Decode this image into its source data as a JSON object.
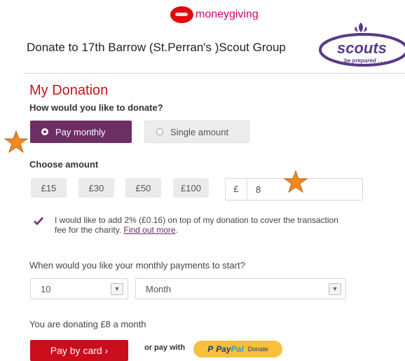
{
  "header": {
    "brand_name": "moneygiving",
    "brand_badge": "Virgin",
    "page_title": "Donate to 17th Barrow (St.Perran's )Scout Group",
    "org_logo_text": "scouts",
    "org_logo_tagline": "be prepared . . ."
  },
  "form": {
    "section_title": "My Donation",
    "frequency_question": "How would you like to donate?",
    "frequency_options": {
      "monthly": "Pay monthly",
      "single": "Single amount"
    },
    "frequency_selected": "monthly",
    "amount_question": "Choose amount",
    "preset_amounts": [
      "£15",
      "£30",
      "£50",
      "£100"
    ],
    "currency_symbol": "£",
    "amount_value": "8",
    "fee_checkbox_checked": true,
    "fee_text": "I would like to add 2% (£0.16) on top of my donation to cover the transaction fee for the charity.",
    "fee_link": "Find out more",
    "fee_period": ".",
    "start_question": "When would you like your monthly payments to start?",
    "start_day": "10",
    "start_month": "Month",
    "summary_text": "You are donating £8 a month",
    "pay_card_label": "Pay by card ›",
    "or_pay_with": "or pay with",
    "paypal": {
      "p": "P",
      "word1": "Pay",
      "word2": "Pal",
      "donate": "Donate"
    }
  },
  "colors": {
    "accent_purple": "#6d2e66",
    "title_red": "#c4151c",
    "pay_red": "#c90d1b",
    "paypal_yellow": "#f7c03a",
    "star_orange": "#f08a1d"
  }
}
